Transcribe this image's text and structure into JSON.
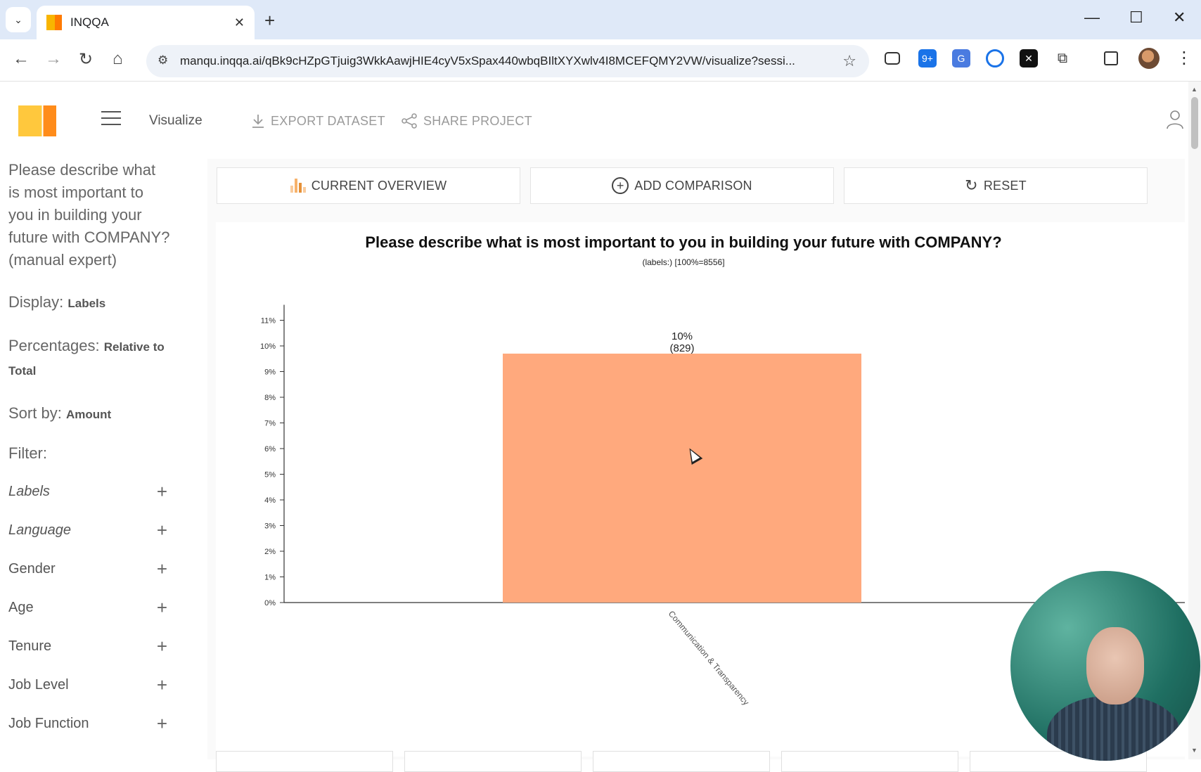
{
  "browser": {
    "tab_title": "INQQA",
    "url": "manqu.inqqa.ai/qBk9cHZpGTjuig3WkkAawjHIE4cyV5xSpax440wbqBIltXYXwlv4I8MCEFQMY2VW/visualize?sessi...",
    "ext_badge": "9+"
  },
  "header": {
    "page_label": "Visualize",
    "export_label": "EXPORT DATASET",
    "share_label": "SHARE PROJECT"
  },
  "sidebar": {
    "question": "Please describe what is most important to you in building your future with COMPANY? (manual expert)",
    "display_label": "Display:",
    "display_value": "Labels",
    "percentages_label": "Percentages:",
    "percentages_value": "Relative to Total",
    "sort_label": "Sort by:",
    "sort_value": "Amount",
    "filter_label": "Filter:",
    "filters": [
      {
        "label": "Labels"
      },
      {
        "label": "Language"
      },
      {
        "label": "Gender"
      },
      {
        "label": "Age"
      },
      {
        "label": "Tenure"
      },
      {
        "label": "Job Level"
      },
      {
        "label": "Job Function"
      }
    ]
  },
  "main": {
    "tabs": {
      "overview": "CURRENT OVERVIEW",
      "comparison": "ADD COMPARISON",
      "reset": "RESET"
    }
  },
  "chart_data": {
    "type": "bar",
    "title": "Please describe what is most important to you in building your future with COMPANY?",
    "subtitle": "(labels:) [100%=8556]",
    "categories": [
      "Communication & Transparency"
    ],
    "values": [
      9.7
    ],
    "data_labels": [
      "10%",
      "(829)"
    ],
    "y_ticks": [
      "0%",
      "1%",
      "2%",
      "3%",
      "4%",
      "5%",
      "6%",
      "7%",
      "8%",
      "9%",
      "10%",
      "11%"
    ],
    "ylim": [
      0,
      11
    ],
    "xlabel": "",
    "ylabel": "",
    "grid": false,
    "bar_color": "#ffa97d"
  },
  "colors": {
    "accent_yellow": "#ffc83d",
    "accent_orange": "#ff8c1a",
    "bar": "#ffa97d"
  }
}
